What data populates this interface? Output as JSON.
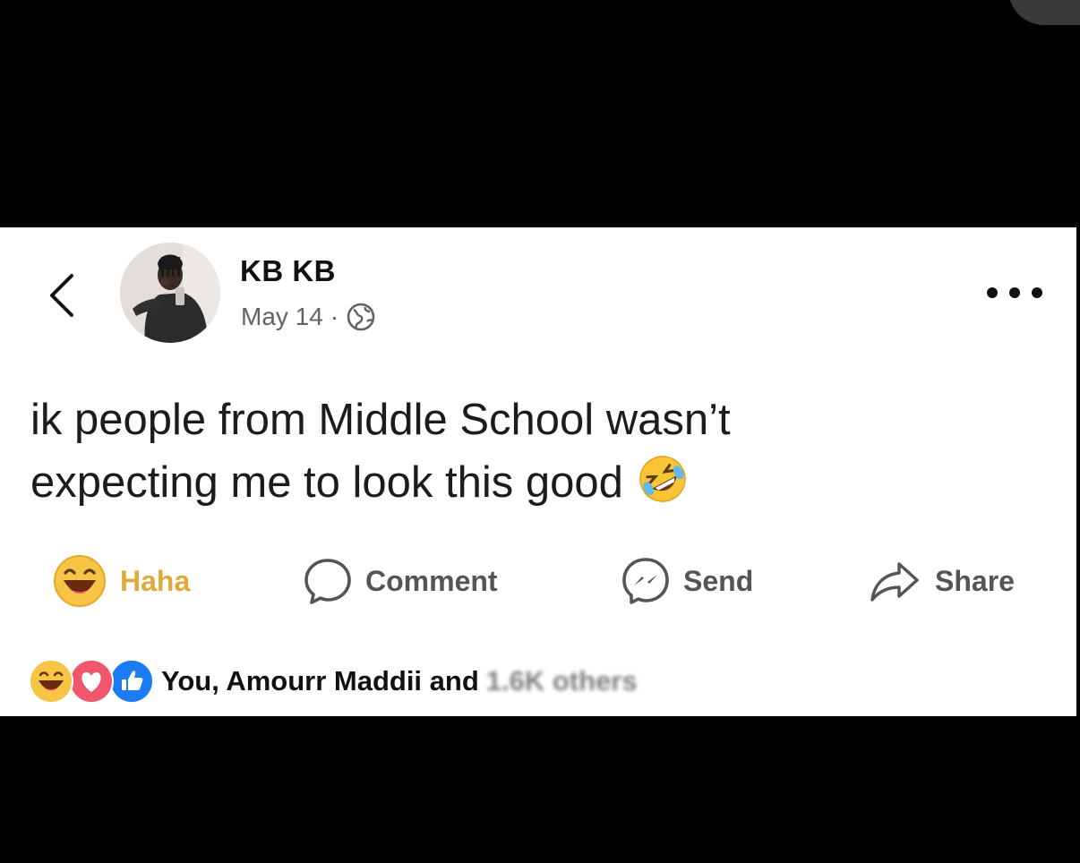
{
  "post": {
    "author": "KB KB",
    "date": "May 14",
    "separator": "·",
    "privacy_icon": "globe-icon",
    "text_line1": "ik people from Middle School wasn’t",
    "text_line2": "expecting me to look this good",
    "text_emoji": "rolling-on-floor-laughing-emoji"
  },
  "actions": {
    "haha_label": "Haha",
    "comment_label": "Comment",
    "send_label": "Send",
    "share_label": "Share"
  },
  "reactions": {
    "icons": [
      "haha-icon",
      "love-icon",
      "like-icon"
    ],
    "summary": "You, Amourr Maddii and",
    "blurred_suffix": "1.6K others"
  },
  "colors": {
    "haha_yellow": "#e0a93c",
    "love_pink": "#f0566c",
    "like_blue": "#1b7cf5"
  }
}
